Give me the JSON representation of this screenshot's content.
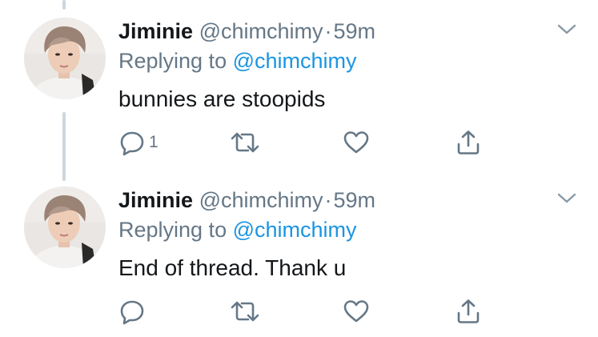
{
  "colors": {
    "text": "#14171a",
    "secondary": "#657786",
    "mention": "#1b95e0",
    "thread_line": "#ccd6dd"
  },
  "tweets": [
    {
      "name": "Jiminie",
      "handle": "@chimchimy",
      "separator": "·",
      "time": "59m",
      "replying_prefix": "Replying to",
      "replying_to": "@chimchimy",
      "text": "bunnies are stoopids",
      "reply_count": "1",
      "icons": [
        "reply-icon",
        "retweet-icon",
        "like-icon",
        "share-icon",
        "chevron-down-icon"
      ]
    },
    {
      "name": "Jiminie",
      "handle": "@chimchimy",
      "separator": "·",
      "time": "59m",
      "replying_prefix": "Replying to",
      "replying_to": "@chimchimy",
      "text": "End of thread. Thank u",
      "reply_count": "",
      "icons": [
        "reply-icon",
        "retweet-icon",
        "like-icon",
        "share-icon",
        "chevron-down-icon"
      ]
    }
  ]
}
